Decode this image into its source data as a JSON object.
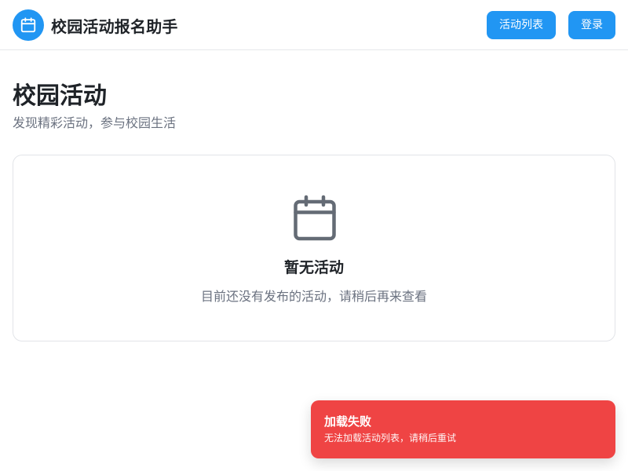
{
  "header": {
    "title": "校园活动报名助手",
    "logo_icon": "calendar-icon",
    "nav": {
      "activities_label": "活动列表",
      "login_label": "登录"
    }
  },
  "main": {
    "title": "校园活动",
    "subtitle": "发现精彩活动，参与校园生活",
    "empty_state": {
      "icon": "calendar-icon",
      "title": "暂无活动",
      "description": "目前还没有发布的活动，请稍后再来查看"
    }
  },
  "toast": {
    "title": "加载失败",
    "message": "无法加载活动列表，请稍后重试"
  },
  "colors": {
    "primary": "#2196f3",
    "danger": "#ef4444",
    "text": "#1f2328",
    "muted": "#6b7280",
    "icon_gray": "#646b75"
  }
}
